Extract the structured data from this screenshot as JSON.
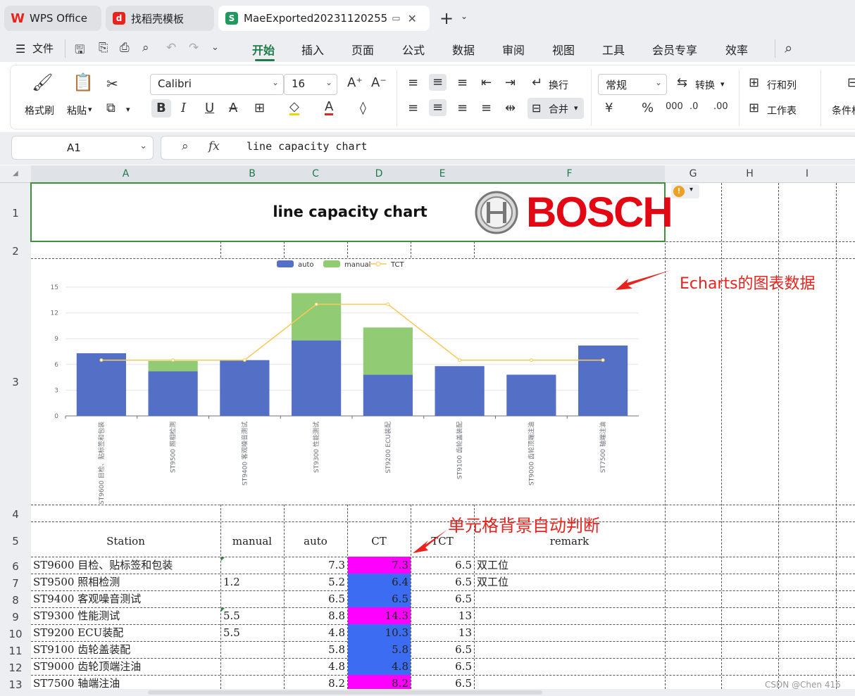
{
  "tabs": [
    {
      "label": "WPS Office",
      "icon": "wps-logo-icon"
    },
    {
      "label": "找稻壳模板",
      "icon": "docer-icon"
    },
    {
      "label": "MaeExported20231120255",
      "icon": "sheet-icon"
    }
  ],
  "menu": {
    "file": "文件",
    "items": [
      "开始",
      "插入",
      "页面",
      "公式",
      "数据",
      "审阅",
      "视图",
      "工具",
      "会员专享",
      "效率"
    ],
    "active": "开始"
  },
  "ribbon": {
    "format_painter": "格式刷",
    "paste": "粘贴",
    "font_name": "Calibri",
    "font_size": "16",
    "wrap": "换行",
    "merge": "合并",
    "number_format": "常规",
    "convert": "转换",
    "rows_cols": "行和列",
    "worksheet": "工作表",
    "conditional": "条件格式",
    "currency": "¥",
    "percent": "%"
  },
  "formula_bar": {
    "cell_ref": "A1",
    "content": "line capacity chart",
    "fx": "fx"
  },
  "columns": [
    "A",
    "B",
    "C",
    "D",
    "E",
    "F",
    "G",
    "H",
    "I"
  ],
  "rows": [
    "1",
    "2",
    "3",
    "4",
    "5",
    "6",
    "7",
    "8",
    "9",
    "10",
    "11",
    "12",
    "13"
  ],
  "sheet": {
    "title": "line capacity chart",
    "logo_text": "BOSCH",
    "headers": {
      "station": "Station",
      "manual": "manual",
      "auto": "auto",
      "ct": "CT",
      "tct": "TCT",
      "remark": "remark"
    },
    "table": [
      {
        "station": "ST9600 目检、贴标签和包装",
        "manual": "",
        "auto": "7.3",
        "ct": "7.3",
        "tct": "6.5",
        "remark": "双工位",
        "ct_color": "#ff00ff"
      },
      {
        "station": "ST9500 照相检测",
        "manual": "1.2",
        "auto": "5.2",
        "ct": "6.4",
        "tct": "6.5",
        "remark": "双工位",
        "ct_color": "#3c6cf2"
      },
      {
        "station": "ST9400 客观噪音测试",
        "manual": "",
        "auto": "6.5",
        "ct": "6.5",
        "tct": "6.5",
        "remark": "",
        "ct_color": "#3c6cf2"
      },
      {
        "station": "ST9300 性能测试",
        "manual": "5.5",
        "auto": "8.8",
        "ct": "14.3",
        "tct": "13",
        "remark": "",
        "ct_color": "#ff00ff"
      },
      {
        "station": "ST9200 ECU装配",
        "manual": "5.5",
        "auto": "4.8",
        "ct": "10.3",
        "tct": "13",
        "remark": "",
        "ct_color": "#3c6cf2"
      },
      {
        "station": "ST9100 齿轮盖装配",
        "manual": "",
        "auto": "5.8",
        "ct": "5.8",
        "tct": "6.5",
        "remark": "",
        "ct_color": "#3c6cf2"
      },
      {
        "station": "ST9000 齿轮顶端注油",
        "manual": "",
        "auto": "4.8",
        "ct": "4.8",
        "tct": "6.5",
        "remark": "",
        "ct_color": "#3c6cf2"
      },
      {
        "station": "ST7500 轴端注油",
        "manual": "",
        "auto": "8.2",
        "ct": "8.2",
        "tct": "6.5",
        "remark": "",
        "ct_color": "#ff00ff"
      }
    ]
  },
  "annotations": {
    "chart_note": "Echarts的图表数据",
    "cell_note": "单元格背景自动判断"
  },
  "watermark": "CSDN @Chen 416",
  "chart_data": {
    "type": "bar",
    "stacked": true,
    "categories": [
      "ST9600 目检、贴标签和包装",
      "ST9500 照相检测",
      "ST9400 客观噪音测试",
      "ST9300 性能测试",
      "ST9200 ECU装配",
      "ST9100 齿轮盖装配",
      "ST9000 齿轮顶端注油",
      "ST7500 轴端注油"
    ],
    "series": [
      {
        "name": "auto",
        "type": "bar",
        "color": "#5470c6",
        "values": [
          7.3,
          5.2,
          6.5,
          8.8,
          4.8,
          5.8,
          4.8,
          8.2
        ]
      },
      {
        "name": "manual",
        "type": "bar",
        "color": "#91cc75",
        "values": [
          0,
          1.2,
          0,
          5.5,
          5.5,
          0,
          0,
          0
        ]
      },
      {
        "name": "TCT",
        "type": "line",
        "color": "#fac858",
        "values": [
          6.5,
          6.5,
          6.5,
          13,
          13,
          6.5,
          6.5,
          6.5
        ]
      }
    ],
    "ylim": [
      0,
      15
    ],
    "yticks": [
      "0",
      "3",
      "6",
      "9",
      "12",
      "15"
    ],
    "legend": "top-center",
    "grid": true
  }
}
